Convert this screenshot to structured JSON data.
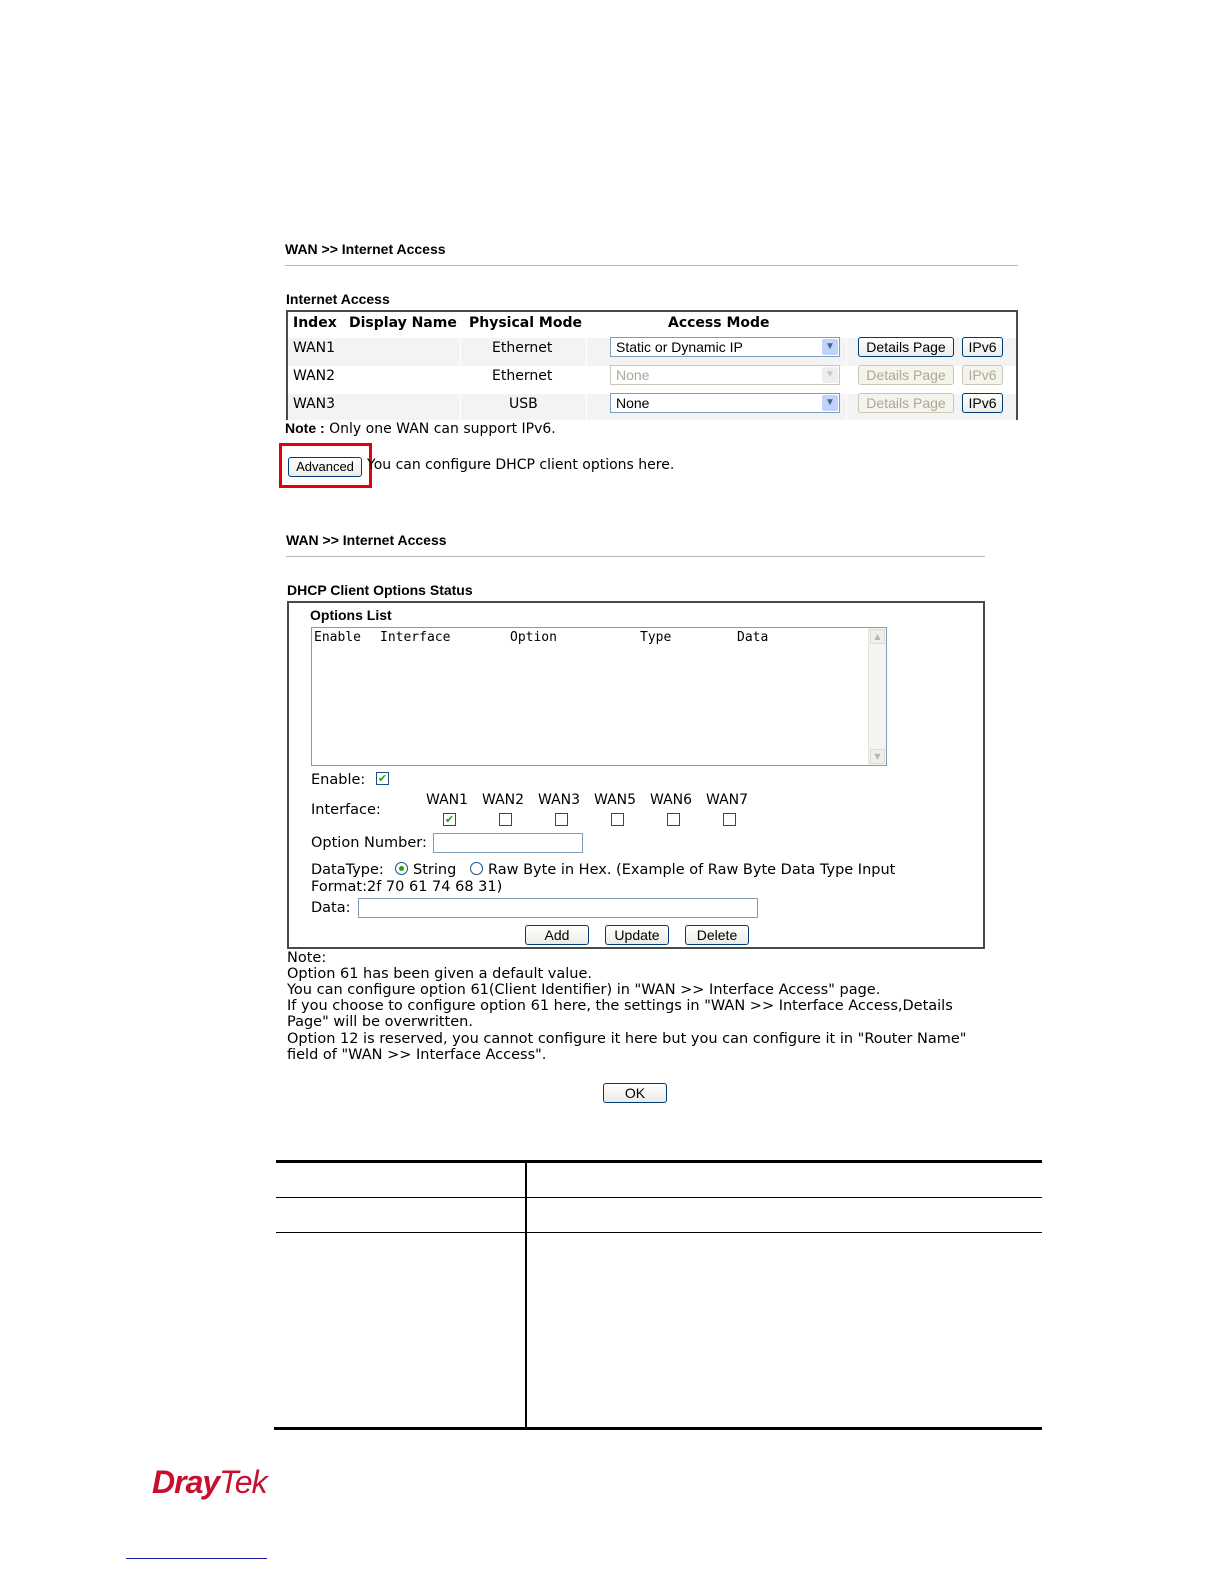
{
  "screen1": {
    "breadcrumb": "WAN >> Internet Access",
    "section_title": "Internet Access",
    "headers": {
      "index": "Index",
      "display_name": "Display Name",
      "physical_mode": "Physical Mode",
      "access_mode": "Access Mode"
    },
    "rows": [
      {
        "index": "WAN1",
        "display_name": "",
        "physical_mode": "Ethernet",
        "access_mode": "Static or Dynamic IP",
        "details": "Details Page",
        "ipv6": "IPv6"
      },
      {
        "index": "WAN2",
        "display_name": "",
        "physical_mode": "Ethernet",
        "access_mode": "None",
        "details": "Details Page",
        "ipv6": "IPv6"
      },
      {
        "index": "WAN3",
        "display_name": "",
        "physical_mode": "USB",
        "access_mode": "None",
        "details": "Details Page",
        "ipv6": "IPv6"
      }
    ],
    "note_label": "Note :",
    "note_text": "Only one WAN can support IPv6.",
    "advanced_button": "Advanced",
    "advanced_text": "You can configure DHCP client options here."
  },
  "screen2": {
    "breadcrumb": "WAN >> Internet Access",
    "section_title": "DHCP Client Options Status",
    "options_list_label": "Options List",
    "list_columns": [
      "Enable",
      "Interface",
      "Option",
      "Type",
      "Data"
    ],
    "enable_label": "Enable:",
    "enable_checked": true,
    "interface_label": "Interface:",
    "interfaces": [
      {
        "name": "WAN1",
        "checked": true
      },
      {
        "name": "WAN2",
        "checked": false
      },
      {
        "name": "WAN3",
        "checked": false
      },
      {
        "name": "WAN5",
        "checked": false
      },
      {
        "name": "WAN6",
        "checked": false
      },
      {
        "name": "WAN7",
        "checked": false
      }
    ],
    "option_number_label": "Option Number:",
    "option_number_value": "",
    "datatype_label": "DataType:",
    "datatype_string": "String",
    "datatype_raw": "Raw Byte in Hex. (Example of Raw Byte Data Type Input",
    "datatype_format": "Format:2f 70 61 74 68 31)",
    "datatype_selected": "String",
    "data_label": "Data:",
    "data_value": "",
    "add_button": "Add",
    "update_button": "Update",
    "delete_button": "Delete",
    "notes": [
      "Note:",
      "Option 61 has been given a default value.",
      "You can configure option 61(Client Identifier) in \"WAN >> Interface Access\" page.",
      "If you choose to configure option 61 here, the settings in \"WAN >> Interface Access,Details",
      "Page\" will be overwritten.",
      "Option 12 is reserved, you cannot configure it here but you can configure it in \"Router Name\"",
      "field of \"WAN >> Interface Access\"."
    ],
    "ok_button": "OK"
  },
  "footer": {
    "logo_text_a": "Dray",
    "logo_text_b": "Tek",
    "logo_color": "#c8102e"
  },
  "colors": {
    "highlight_border": "#e0000f",
    "check_green": "#21a121"
  }
}
